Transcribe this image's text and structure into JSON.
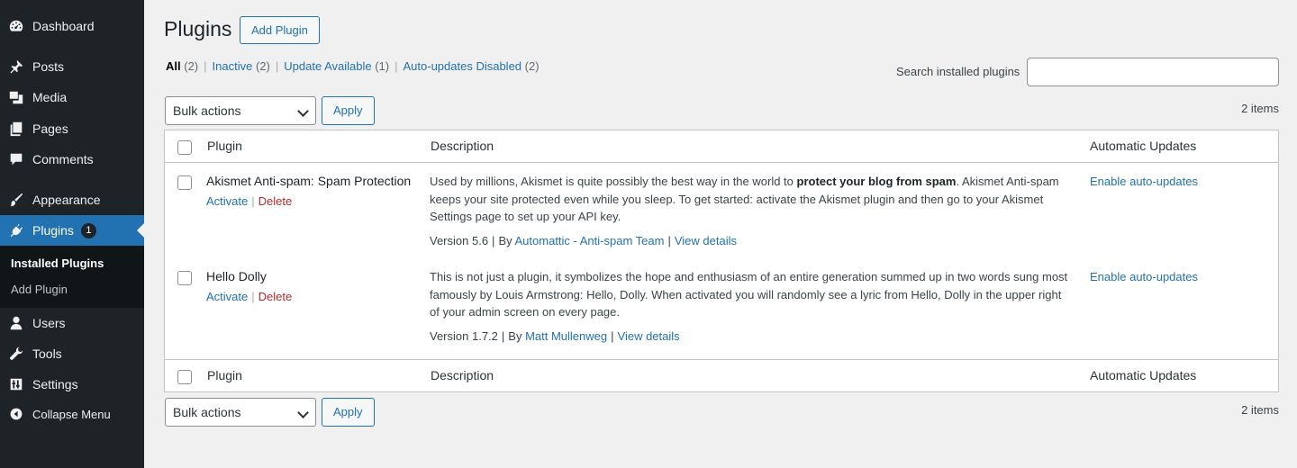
{
  "sidebar": {
    "items": [
      {
        "label": "Dashboard",
        "icon": "dashboard-icon"
      },
      {
        "label": "Posts",
        "icon": "pin-icon"
      },
      {
        "label": "Media",
        "icon": "media-icon"
      },
      {
        "label": "Pages",
        "icon": "pages-icon"
      },
      {
        "label": "Comments",
        "icon": "comment-icon"
      },
      {
        "label": "Appearance",
        "icon": "brush-icon"
      },
      {
        "label": "Plugins",
        "icon": "plug-icon",
        "badge": "1",
        "current": true
      },
      {
        "label": "Users",
        "icon": "user-icon"
      },
      {
        "label": "Tools",
        "icon": "wrench-icon"
      },
      {
        "label": "Settings",
        "icon": "sliders-icon"
      },
      {
        "label": "Collapse Menu",
        "icon": "collapse-icon"
      }
    ],
    "submenu": [
      {
        "label": "Installed Plugins",
        "current": true
      },
      {
        "label": "Add Plugin"
      }
    ]
  },
  "header": {
    "title": "Plugins",
    "add_button": "Add Plugin"
  },
  "filters": [
    {
      "label": "All",
      "count": "(2)",
      "current": true
    },
    {
      "label": "Inactive",
      "count": "(2)"
    },
    {
      "label": "Update Available",
      "count": "(1)"
    },
    {
      "label": "Auto-updates Disabled",
      "count": "(2)"
    }
  ],
  "search": {
    "label": "Search installed plugins",
    "value": ""
  },
  "bulk": {
    "select_value": "Bulk actions",
    "apply_label": "Apply",
    "item_count": "2 items"
  },
  "table": {
    "columns": [
      "Plugin",
      "Description",
      "Automatic Updates"
    ],
    "rows": [
      {
        "name": "Akismet Anti-spam: Spam Protection",
        "activate": "Activate",
        "delete": "Delete",
        "desc_before": "Used by millions, Akismet is quite possibly the best way in the world to ",
        "desc_bold": "protect your blog from spam",
        "desc_after": ". Akismet Anti-spam keeps your site protected even while you sleep. To get started: activate the Akismet plugin and then go to your Akismet Settings page to set up your API key.",
        "version": "Version 5.6",
        "by": "By",
        "author": "Automattic - Anti-spam Team",
        "details": "View details",
        "auto_update": "Enable auto-updates"
      },
      {
        "name": "Hello Dolly",
        "activate": "Activate",
        "delete": "Delete",
        "desc_before": "This is not just a plugin, it symbolizes the hope and enthusiasm of an entire generation summed up in two words sung most famously by Louis Armstrong: Hello, Dolly. When activated you will randomly see a lyric from Hello, Dolly in the upper right of your admin screen on every page.",
        "desc_bold": "",
        "desc_after": "",
        "version": "Version 1.7.2",
        "by": "By",
        "author": "Matt Mullenweg",
        "details": "View details",
        "auto_update": "Enable auto-updates"
      }
    ]
  },
  "colors": {
    "sidebar_bg": "#1d2327",
    "accent": "#2271b1",
    "delete": "#b32d2e"
  }
}
